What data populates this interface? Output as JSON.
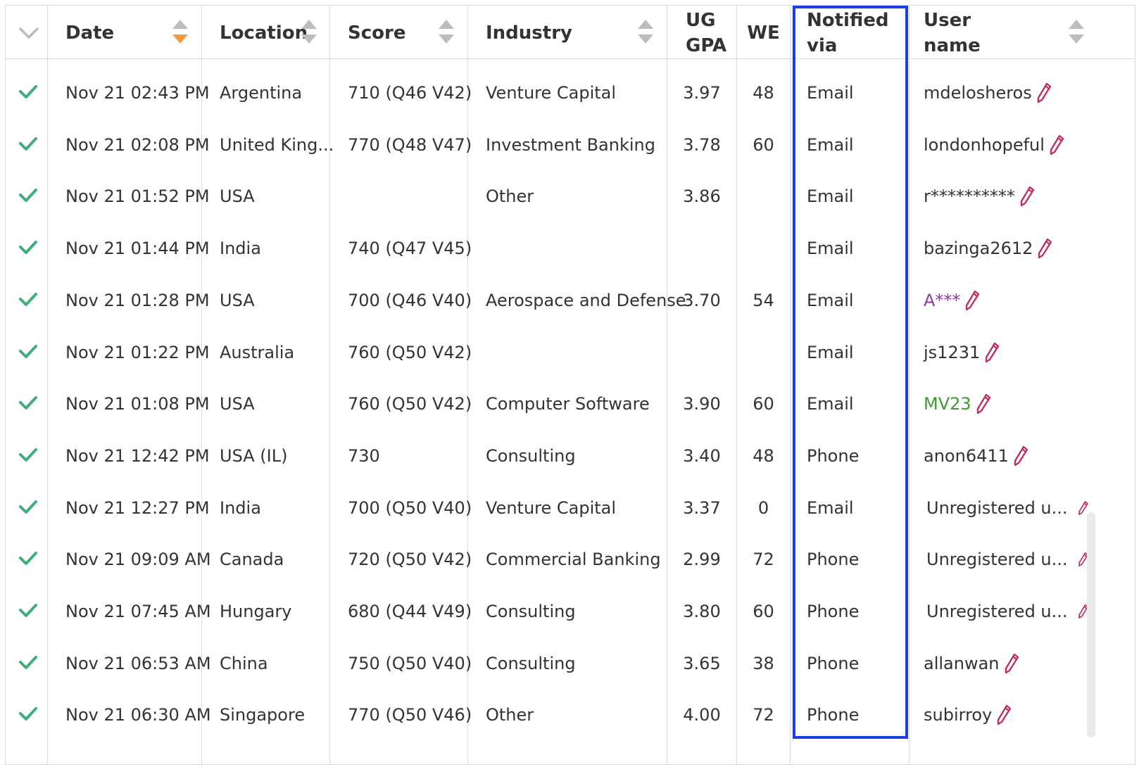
{
  "table": {
    "select_all_icon": "chevron-down-icon",
    "columns": [
      {
        "key": "date",
        "label": "Date",
        "sortable": true,
        "sort_state": "desc"
      },
      {
        "key": "location",
        "label": "Location",
        "sortable": true
      },
      {
        "key": "score",
        "label": "Score",
        "sortable": true
      },
      {
        "key": "industry",
        "label": "Industry",
        "sortable": true
      },
      {
        "key": "ug_gpa",
        "label_line1": "UG",
        "label_line2": "GPA",
        "sortable": false
      },
      {
        "key": "we",
        "label": "WE",
        "sortable": false
      },
      {
        "key": "notified",
        "label_line1": "Notified",
        "label_line2": "via",
        "sortable": false,
        "highlighted": true
      },
      {
        "key": "username",
        "label_line1": "User",
        "label_line2": "name",
        "sortable": true
      }
    ],
    "rows": [
      {
        "date": "Nov 21 02:43 PM",
        "location": "Argentina",
        "score": "710 (Q46 V42)",
        "industry": "Venture Capital",
        "gpa": "3.97",
        "we": "48",
        "notified": "Email",
        "user": "mdelosheros",
        "user_style": "normal"
      },
      {
        "date": "Nov 21 02:08 PM",
        "location": "United King...",
        "score": "770 (Q48 V47)",
        "industry": "Investment Banking",
        "gpa": "3.78",
        "we": "60",
        "notified": "Email",
        "user": "londonhopeful",
        "user_style": "normal"
      },
      {
        "date": "Nov 21 01:52 PM",
        "location": "USA",
        "score": "",
        "industry": "Other",
        "gpa": "3.86",
        "we": "",
        "notified": "Email",
        "user": "r**********",
        "user_style": "normal"
      },
      {
        "date": "Nov 21 01:44 PM",
        "location": "India",
        "score": "740 (Q47 V45)",
        "industry": "",
        "gpa": "",
        "we": "",
        "notified": "Email",
        "user": "bazinga2612",
        "user_style": "normal"
      },
      {
        "date": "Nov 21 01:28 PM",
        "location": "USA",
        "score": "700 (Q46 V40)",
        "industry": "Aerospace and Defense",
        "gpa": "3.70",
        "we": "54",
        "notified": "Email",
        "user": "A***",
        "user_style": "purple"
      },
      {
        "date": "Nov 21 01:22 PM",
        "location": "Australia",
        "score": "760 (Q50 V42)",
        "industry": "",
        "gpa": "",
        "we": "",
        "notified": "Email",
        "user": "js1231",
        "user_style": "normal"
      },
      {
        "date": "Nov 21 01:08 PM",
        "location": "USA",
        "score": "760 (Q50 V42)",
        "industry": "Computer Software",
        "gpa": "3.90",
        "we": "60",
        "notified": "Email",
        "user": "MV23",
        "user_style": "green"
      },
      {
        "date": "Nov 21 12:42 PM",
        "location": "USA (IL)",
        "score": "730",
        "industry": "Consulting",
        "gpa": "3.40",
        "we": "48",
        "notified": "Phone",
        "user": "anon6411",
        "user_style": "normal"
      },
      {
        "date": "Nov 21 12:27 PM",
        "location": "India",
        "score": "700 (Q50 V40)",
        "industry": "Venture Capital",
        "gpa": "3.37",
        "we": "0",
        "notified": "Email",
        "user": "Unregistered u...",
        "user_style": "unregistered"
      },
      {
        "date": "Nov 21 09:09 AM",
        "location": "Canada",
        "score": "720 (Q50 V42)",
        "industry": "Commercial Banking",
        "gpa": "2.99",
        "we": "72",
        "notified": "Phone",
        "user": "Unregistered u...",
        "user_style": "unregistered"
      },
      {
        "date": "Nov 21 07:45 AM",
        "location": "Hungary",
        "score": "680 (Q44 V49)",
        "industry": "Consulting",
        "gpa": "3.80",
        "we": "60",
        "notified": "Phone",
        "user": "Unregistered u...",
        "user_style": "unregistered"
      },
      {
        "date": "Nov 21 06:53 AM",
        "location": "China",
        "score": "750 (Q50 V40)",
        "industry": "Consulting",
        "gpa": "3.65",
        "we": "38",
        "notified": "Phone",
        "user": "allanwan",
        "user_style": "normal"
      },
      {
        "date": "Nov 21 06:30 AM",
        "location": "Singapore",
        "score": "770 (Q50 V46)",
        "industry": "Other",
        "gpa": "4.00",
        "we": "72",
        "notified": "Phone",
        "user": "subirroy",
        "user_style": "normal"
      }
    ],
    "row_status_icon": "check-icon",
    "edit_icon": "pencil-icon"
  },
  "colors": {
    "check": "#3fae7a",
    "pencil": "#c0305a",
    "highlight": "#1a3fe0",
    "sort_active": "#f39c3f",
    "user_purple": "#8e3a9d",
    "user_green": "#3c9a2e"
  }
}
